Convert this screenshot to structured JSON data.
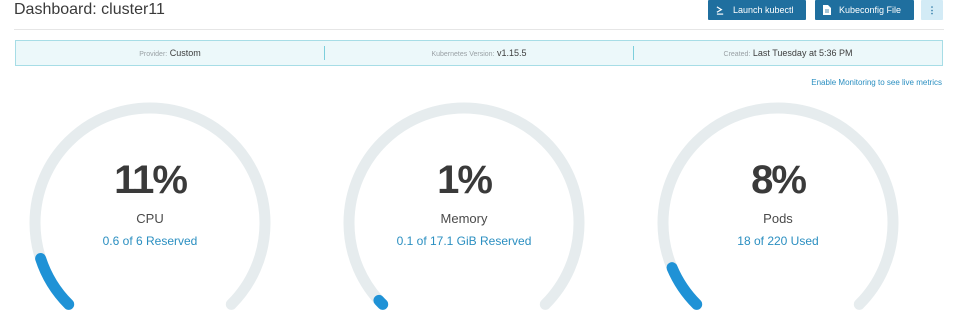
{
  "header": {
    "title": "Dashboard: cluster11",
    "launch_kubectl_label": "Launch kubectl",
    "kubeconfig_label": "Kubeconfig File",
    "more_label": "⋮"
  },
  "info": {
    "provider_label": "Provider:",
    "provider_value": "Custom",
    "k8s_label": "Kubernetes Version:",
    "k8s_value": "v1.15.5",
    "created_label": "Created:",
    "created_value": "Last Tuesday at 5:36 PM"
  },
  "monitoring_link": "Enable Monitoring to see live metrics",
  "colors": {
    "accent": "#2b8fc1",
    "gauge_track": "#e6ecee",
    "gauge_fill": "#1f92d6",
    "button": "#1f6f9f"
  },
  "gauges": [
    {
      "percent_label": "11%",
      "name": "CPU",
      "detail": "0.6 of 6 Reserved",
      "fraction": 0.1
    },
    {
      "percent_label": "1%",
      "name": "Memory",
      "detail": "0.1 of 17.1 GiB Reserved",
      "fraction": 0.01
    },
    {
      "percent_label": "8%",
      "name": "Pods",
      "detail": "18 of 220 Used",
      "fraction": 0.082
    }
  ]
}
